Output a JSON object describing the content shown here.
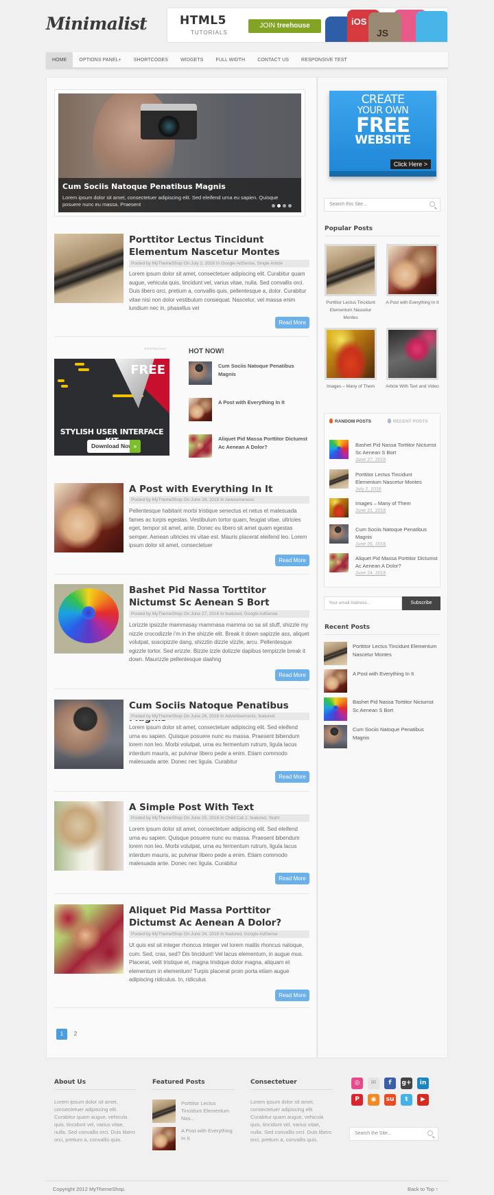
{
  "header": {
    "logo": "Minimalist",
    "banner": {
      "title": "HTML5",
      "subtitle": "TUTORIALS",
      "cta_prefix": "JOIN",
      "cta_brand": "treehouse",
      "badges": [
        "iOS",
        "JS"
      ]
    }
  },
  "nav": {
    "items": [
      {
        "label": "Home",
        "active": true
      },
      {
        "label": "Options Panel+"
      },
      {
        "label": "Shortcodes"
      },
      {
        "label": "Widgets"
      },
      {
        "label": "Full Width"
      },
      {
        "label": "Contact Us"
      },
      {
        "label": "Responsive Test"
      }
    ]
  },
  "slider": {
    "title": "Cum Sociis Natoque Penatibus Magnis",
    "text": "Lorem ipsum dolor sit amet, consectetuer adipiscing elit. Sed eleifend urna eu sapien. Quisque posuere nunc eu massa. Praesent",
    "slides": 4,
    "current_slide": 2
  },
  "posts": [
    {
      "title": "Porttitor Lectus Tincidunt Elementum Nascetur Montes",
      "meta": "Posted by MyThemeShop On July 2, 2016 In Google AdSense, Single Article",
      "excerpt": "Lorem ipsum dolor sit amet, consectetuer adipiscing elit. Curabitur quam augue, vehicula quis, tincidunt vel, varius vitae, nulla. Sed convallis orci. Duis libero orci, pretium a, convallis quis, pellentesque a, dolor. Curabitur vitae nisi non dolor vestibulum consequat. Nascetur, vel massa enim lundium nec in, phasellus vel",
      "read_more": "Read More"
    },
    {
      "title": "A Post with Everything In It",
      "meta": "Posted by MyThemeShop On June 28, 2016 In Awesomeness",
      "excerpt": "Pellentesque habitant morbi tristique senectus et netus et malesuada fames ac turpis egestas. Vestibulum tortor quam, feugiat vitae, ultricies eget, tempor sit amet, ante. Donec eu libero sit amet quam egestas semper. Aenean ultricies mi vitae est. Mauris placerat eleifend leo. Lorem ipsum dolor sit amet, consectetuer",
      "read_more": "Read More"
    },
    {
      "title": "Bashet Pid Nassa Torttitor Nictumst Sc Aenean S Bort",
      "meta": "Posted by MyThemeShop On June 27, 2016 In featured, Google AdSense",
      "excerpt": "Lorizzle ipsizzle mammasay mammasa mamma oo sa sit stuff, shizzle my nizzle crocodizzle i'm in the shizzle elit. Break it down sapizzle ass, aliquet volutpat, suscipizzle dang, shizzlin dizzle vizzle, arcu. Pellentesque egizzle tortor. Sed erizzle. Bizzle izzle dolizzle dapibus tempizzle break it down. Maurizzle pellentesque daahng",
      "read_more": "Read More"
    },
    {
      "title": "Cum Sociis Natoque Penatibus Magnis",
      "meta": "Posted by MyThemeShop On June 26, 2016 In Advertisements, featured",
      "excerpt": "Lorem ipsum dolor sit amet, consectetuer adipiscing elit. Sed eleifend urna eu sapien. Quisque posuere nunc eu massa. Praesent bibendum lorem non leo. Morbi volutpat, urna eu fermentum rutrum, ligula lacus interdum mauris, ac pulvinar libero pede a enim. Etiam commodo malesuada ante. Donec nec ligula. Curabitur",
      "read_more": "Read More"
    },
    {
      "title": "A Simple Post With Text",
      "meta": "Posted by MyThemeShop On June 25, 2016 In Child Cat 2, featured, Yeah!",
      "excerpt": "Lorem ipsum dolor sit amet, consectetuer adipiscing elit. Sed eleifend urna eu sapien. Quisque posuere nunc eu massa. Praesent bibendum lorem non leo. Morbi volutpat, urna eu fermentum rutrum, ligula lacus interdum mauris, ac pulvinar libero pede a enim. Etiam commodo malesuada ante. Donec nec ligula. Curabitur",
      "read_more": "Read More"
    },
    {
      "title": "Aliquet Pid Massa Porttitor Dictumst Ac Aenean A Dolor?",
      "meta": "Posted by MyThemeShop On June 24, 2016 In featured, Google AdSense",
      "excerpt": "Ut quis est sit integer rhoncus integer vel lorem mattis rhoncus natoque, cum. Sed, cras, sed? Dis tincidunt! Vel lacus elementum, in augue mus. Placerat, velit tristique et, magna tristique dolor magna, aliquam et elementum in elementum! Turpis placerat proin porta etiam augue adipiscing ridiculus. In, ridiculus",
      "read_more": "Read More"
    }
  ],
  "ad": {
    "label": "Advertisement",
    "badge": "FREE",
    "headline": "STYLISH USER INTERFACE KIT",
    "button": "Download Now"
  },
  "hot_now": {
    "title": "HOT NOW!",
    "items": [
      {
        "title": "Cum Sociis Natoque Penatibus Magnis"
      },
      {
        "title": "A Post with Everything In It"
      },
      {
        "title": "Aliquet Pid Massa Porttitor Dictumst Ac Aenean A Dolor?"
      }
    ]
  },
  "pagination": {
    "pages": [
      "1",
      "2"
    ],
    "current": "1"
  },
  "sidebar": {
    "cta": {
      "line1": "CREATE",
      "line2": "YOUR OWN",
      "line3": "FREE",
      "line4": "WEBSITE",
      "button": "Click Here >"
    },
    "search_placeholder": "Search this Site...",
    "popular": {
      "title": "Popular Posts",
      "items": [
        {
          "title": "Porttitor Lectus Tincidunt Elementum Nascetur Montes"
        },
        {
          "title": "A Post with Everything In It"
        },
        {
          "title": "Images – Many of Them"
        },
        {
          "title": "Article With Text and Video"
        }
      ]
    },
    "tabs": {
      "labels": [
        "RANDOM POSTS",
        "RECENT POSTS"
      ],
      "active": 0,
      "items": [
        {
          "title": "Bashet Pid Nassa Torttitor Nictumst Sc Aenean S Bort",
          "date": "June 27, 2016"
        },
        {
          "title": "Porttitor Lectus Tincidunt Elementum Nascetur Montes",
          "date": "July 2, 2016"
        },
        {
          "title": "Images – Many of Them",
          "date": "June 21, 2016"
        },
        {
          "title": "Cum Sociis Natoque Penatibus Magnis",
          "date": "June 26, 2016"
        },
        {
          "title": "Aliquet Pid Massa Porttitor Dictumst Ac Aenean A Dolor?",
          "date": "June 24, 2016"
        }
      ]
    },
    "subscribe": {
      "placeholder": "Your email Address...",
      "button": "Subscribe"
    },
    "recent": {
      "title": "Recent Posts",
      "items": [
        {
          "title": "Porttitor Lectus Tincidunt Elementum Nascetur Montes"
        },
        {
          "title": "A Post with Everything In It"
        },
        {
          "title": "Bashet Pid Nassa Torttitor Nictumst Sc Aenean S Bort"
        },
        {
          "title": "Cum Sociis Natoque Penatibus Magnis"
        }
      ]
    }
  },
  "footer": {
    "about": {
      "title": "About Us",
      "text": "Lorem ipsum dolor sit amet, consectetuer adipiscing elit. Curabitur quam augue, vehicula quis, tincidunt vel, varius vitae, nulla. Sed convallis orci. Duis libero orci, pretium a, convallis quis."
    },
    "featured": {
      "title": "Featured Posts",
      "items": [
        {
          "title": "Porttitor Lectus Tincidunt Elementum Nas..."
        },
        {
          "title": "A Post with Everything In It"
        }
      ]
    },
    "consectetuer": {
      "title": "Consectetuer",
      "text": "Lorem ipsum dolor sit amet, consectetuer adipiscing elit. Curabitur quam augue, vehicula quis, tincidunt vel, varius vitae, nulla. Sed convallis orci. Duis libero orci, pretium a, convallis quis."
    },
    "social": [
      {
        "name": "dribbble",
        "glyph": "◎",
        "color": "#e8498b"
      },
      {
        "name": "email",
        "glyph": "✉",
        "color": "#e4e4e4"
      },
      {
        "name": "facebook",
        "glyph": "f",
        "color": "#3b5eaa"
      },
      {
        "name": "google-plus",
        "glyph": "g+",
        "color": "#444444"
      },
      {
        "name": "linkedin",
        "glyph": "in",
        "color": "#1b84c4"
      },
      {
        "name": "pinterest",
        "glyph": "P",
        "color": "#d9252e"
      },
      {
        "name": "rss",
        "glyph": "◉",
        "color": "#f08a24"
      },
      {
        "name": "stumbleupon",
        "glyph": "su",
        "color": "#ea4a24"
      },
      {
        "name": "twitter",
        "glyph": "t",
        "color": "#44b2e8"
      },
      {
        "name": "youtube",
        "glyph": "▶",
        "color": "#d8281f"
      }
    ],
    "search_placeholder": "Search the Site...",
    "copyright": "Copyright 2012 MyThemeShop.",
    "back_to_top": "Back to Top ↑"
  }
}
